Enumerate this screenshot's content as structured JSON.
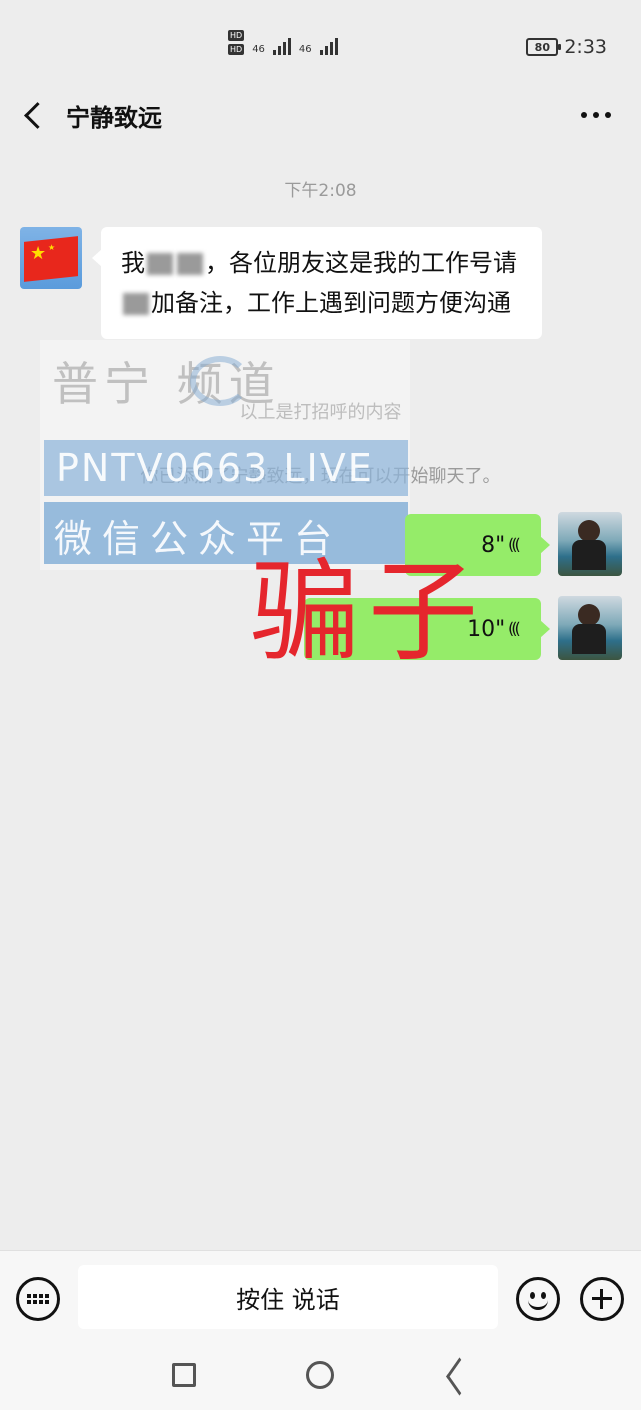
{
  "status_bar": {
    "hd1": "HD",
    "hd2": "HD",
    "net1": "46",
    "net2": "46",
    "battery": "80",
    "time": "2:33"
  },
  "header": {
    "title": "宁静致远",
    "back_icon": "chevron-left-icon",
    "more_icon": "more-dots-icon"
  },
  "chat": {
    "timestamp": "下午2:08",
    "incoming_message": {
      "part1": "我",
      "part2": "，各位朋友这是我的工作号请",
      "part3": "加备注，工作上遇到问题方便沟通"
    },
    "system_messages": [
      "以上是打招呼的内容",
      "你已添加了宁静致远，现在可以开始聊天了。"
    ],
    "voice_messages": [
      {
        "duration": "8\""
      },
      {
        "duration": "10\""
      }
    ]
  },
  "watermark": {
    "title": "普宁  频道",
    "code": "PNTV0663 LIVE",
    "subtitle": "微信公众平台"
  },
  "overlay_label": "骗子",
  "input_bar": {
    "talk_label": "按住 说话"
  },
  "colors": {
    "bubble_out": "#95ec69",
    "bubble_in": "#ffffff",
    "background": "#ededed",
    "overlay_red": "#e5262d"
  }
}
